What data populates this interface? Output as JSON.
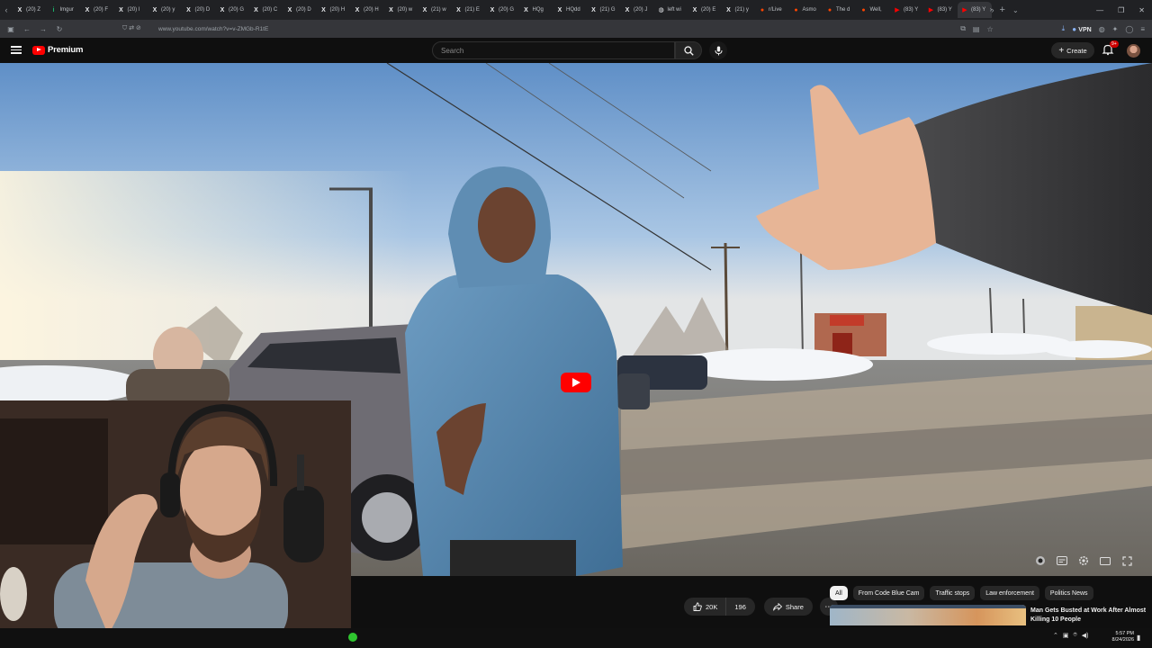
{
  "browser": {
    "tabs": [
      {
        "favicon": "x-logo-icon",
        "label": "(20) Z"
      },
      {
        "favicon": "imgur-icon",
        "label": "Imgur"
      },
      {
        "favicon": "x-logo-icon",
        "label": "(20) F"
      },
      {
        "favicon": "x-logo-icon",
        "label": "(20) I"
      },
      {
        "favicon": "x-logo-icon",
        "label": "(20) y"
      },
      {
        "favicon": "x-logo-icon",
        "label": "(20) D"
      },
      {
        "favicon": "x-logo-icon",
        "label": "(20) G"
      },
      {
        "favicon": "x-logo-icon",
        "label": "(20) C"
      },
      {
        "favicon": "x-logo-icon",
        "label": "(20) D"
      },
      {
        "favicon": "x-logo-icon",
        "label": "(20) H"
      },
      {
        "favicon": "x-logo-icon",
        "label": "(20) H"
      },
      {
        "favicon": "x-logo-icon",
        "label": "(20) w"
      },
      {
        "favicon": "x-logo-icon",
        "label": "(21) w"
      },
      {
        "favicon": "x-logo-icon",
        "label": "(21) E"
      },
      {
        "favicon": "x-logo-icon",
        "label": "(20) G"
      },
      {
        "favicon": "x-logo-icon",
        "label": "HQg"
      },
      {
        "favicon": "x-logo-icon",
        "label": "HQdd"
      },
      {
        "favicon": "x-logo-icon",
        "label": "(21) G"
      },
      {
        "favicon": "x-logo-icon",
        "label": "(20) J"
      },
      {
        "favicon": "globe-icon",
        "label": "left wi"
      },
      {
        "favicon": "x-logo-icon",
        "label": "(20) E"
      },
      {
        "favicon": "x-logo-icon",
        "label": "(21) y"
      },
      {
        "favicon": "reddit-icon",
        "label": "r/Live"
      },
      {
        "favicon": "reddit-icon",
        "label": "Asmo"
      },
      {
        "favicon": "reddit-icon",
        "label": "The d"
      },
      {
        "favicon": "reddit-icon",
        "label": "Well,"
      },
      {
        "favicon": "youtube-icon",
        "label": "(83) Y"
      },
      {
        "favicon": "youtube-icon",
        "label": "(83) Y"
      },
      {
        "favicon": "youtube-icon",
        "label": "(83) Y",
        "active": true
      }
    ],
    "url": "www.youtube.com/watch?v=v-ZMGb-R1tE",
    "vpn_label": "VPN"
  },
  "youtube": {
    "logo_text": "Premium",
    "search_placeholder": "Search",
    "create_label": "Create",
    "notification_count": "9+"
  },
  "actions": {
    "likes": "20K",
    "dislikes": "196",
    "share_label": "Share"
  },
  "chips": [
    "All",
    "From Code Blue Cam",
    "Traffic stops",
    "Law enforcement",
    "Politics News"
  ],
  "recommendation": {
    "title": "Man Gets Busted at Work After Almost Killing 10 People"
  },
  "taskbar": {
    "time": "5:57 PM",
    "date": "8/24/2026"
  },
  "colors": {
    "brand_red": "#ff0000",
    "background": "#0f0f0f",
    "chip_bg": "#272727"
  }
}
